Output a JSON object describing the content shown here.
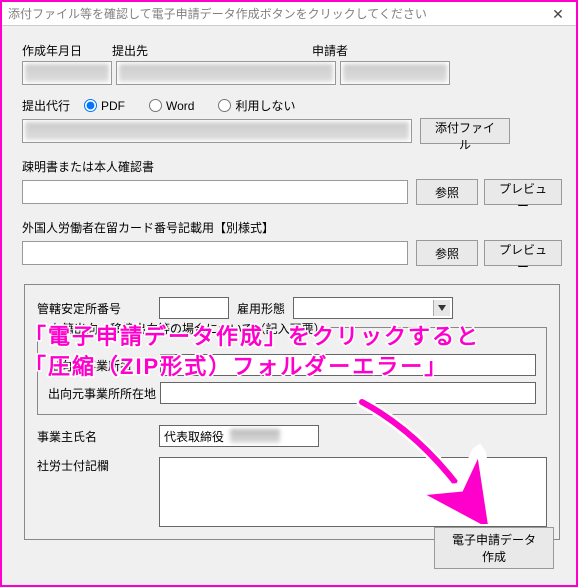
{
  "window": {
    "title": "添付ファイル等を確認して電子申請データ作成ボタンをクリックしてください",
    "close": "✕"
  },
  "header": {
    "col1_label": "作成年月日",
    "col2_label": "提出先",
    "col3_label": "申請者"
  },
  "proxy": {
    "label": "提出代行",
    "options": {
      "pdf": "PDF",
      "word": "Word",
      "none": "利用しない"
    },
    "selected": "pdf",
    "attach_button": "添付ファイル"
  },
  "proof": {
    "label": "疎明書または本人確認書",
    "browse": "参照",
    "preview": "プレビュー"
  },
  "foreign": {
    "label": "外国人労働者在留カード番号記載用【別様式】",
    "browse": "参照",
    "preview": "プレビュー"
  },
  "group": {
    "office_no_label": "管轄安定所番号",
    "office_no_value": "",
    "emp_type_label": "雇用形態",
    "emp_type_value": "",
    "fieldset_legend": "在籍出向・移籍出向等の場合について（記入不要）",
    "fs_label1": "出向元事業所名",
    "fs_label2": "出向元事業所所在地",
    "owner_label": "事業主氏名",
    "owner_prefix": "代表取締役",
    "sharoshi_label": "社労士付記欄"
  },
  "submit_button": "電子申請データ作成",
  "overlay": {
    "line1": "「電子申請データ作成」をクリックすると",
    "line2": "「圧縮（ZIP形式）フォルダーエラー」"
  }
}
